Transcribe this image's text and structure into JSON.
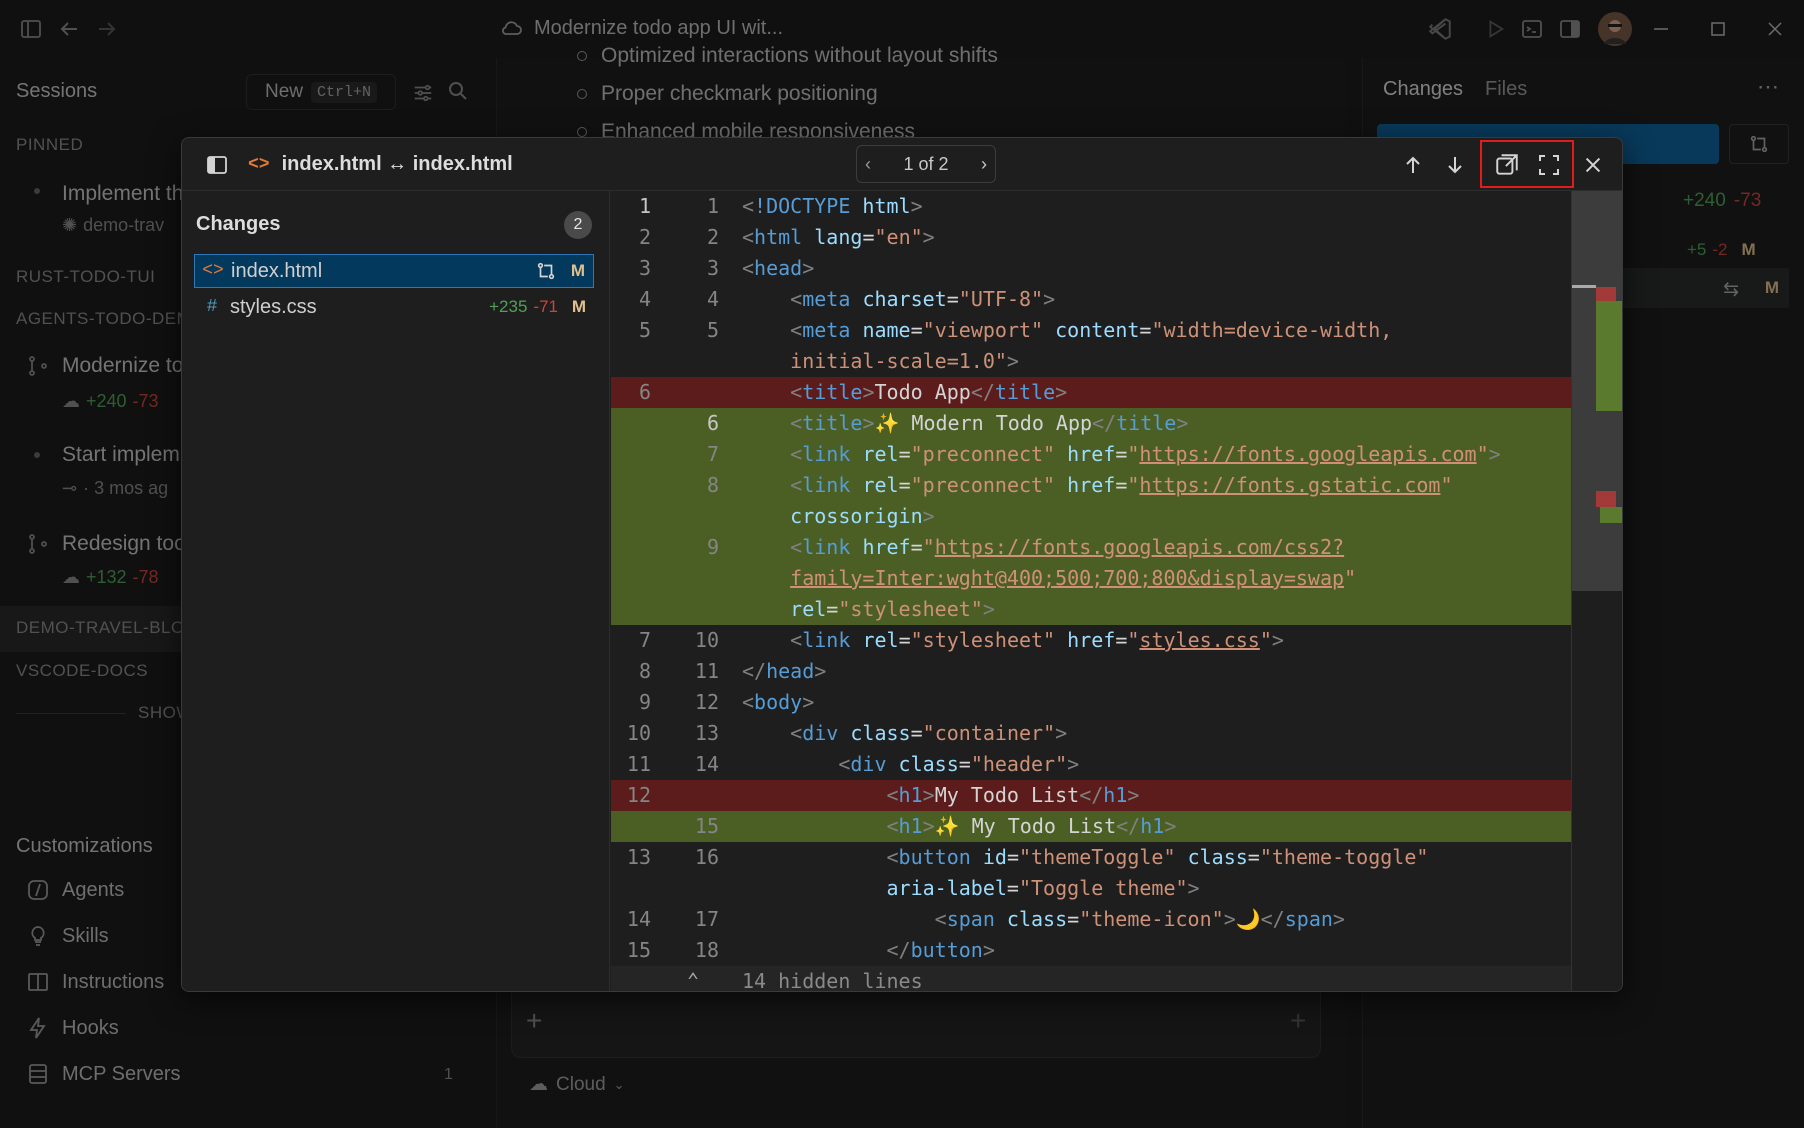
{
  "window": {
    "title": "Modernize todo app UI wit..."
  },
  "sidebar": {
    "heading": "Sessions",
    "new_label": "New",
    "new_shortcut": "Ctrl+N",
    "sections": {
      "pinned": "PINNED",
      "rust": "RUST-TODO-TUI",
      "agents": "AGENTS-TODO-DEM",
      "travel": "DEMO-TRAVEL-BLO",
      "vscode": "VSCODE-DOCS"
    },
    "sessions": [
      {
        "title": "Implement th",
        "meta": "demo-trav"
      },
      {
        "title": "Modernize to",
        "added": "+240",
        "removed": "-73"
      },
      {
        "title": "Start implem",
        "meta": "· 3 mos ag"
      },
      {
        "title": "Redesign too",
        "added": "+132",
        "removed": "-78"
      }
    ],
    "show_more": "SHOW",
    "customizations": {
      "heading": "Customizations",
      "items": [
        {
          "label": "Agents"
        },
        {
          "label": "Skills"
        },
        {
          "label": "Instructions"
        },
        {
          "label": "Hooks"
        },
        {
          "label": "MCP Servers",
          "count": "1"
        }
      ]
    }
  },
  "chat": {
    "bullets": [
      "Optimized interactions without layout shifts",
      "Proper checkmark positioning",
      "Enhanced mobile responsiveness"
    ],
    "cloud_label": "Cloud"
  },
  "right_panel": {
    "tabs": [
      "Changes",
      "Files"
    ],
    "summary_added": "+240",
    "summary_removed": "-73",
    "row1_added": "+5",
    "row1_removed": "-2",
    "row_badge": "M"
  },
  "diff_modal": {
    "title": "index.html ↔ index.html",
    "pager": "1 of 2",
    "changes_title": "Changes",
    "changes_count": "2",
    "files": [
      {
        "name": "index.html",
        "icon": "<>",
        "badge": "M"
      },
      {
        "name": "styles.css",
        "icon": "#",
        "added": "+235",
        "removed": "-71",
        "badge": "M"
      }
    ],
    "hidden_lines": "14 hidden lines"
  },
  "colors": {
    "deleted_bg": "#5c1c1c",
    "inserted_bg": "#4b5f24",
    "selection": "#04395e",
    "accent": "#0e639c",
    "highlight": "#e01c1c"
  }
}
